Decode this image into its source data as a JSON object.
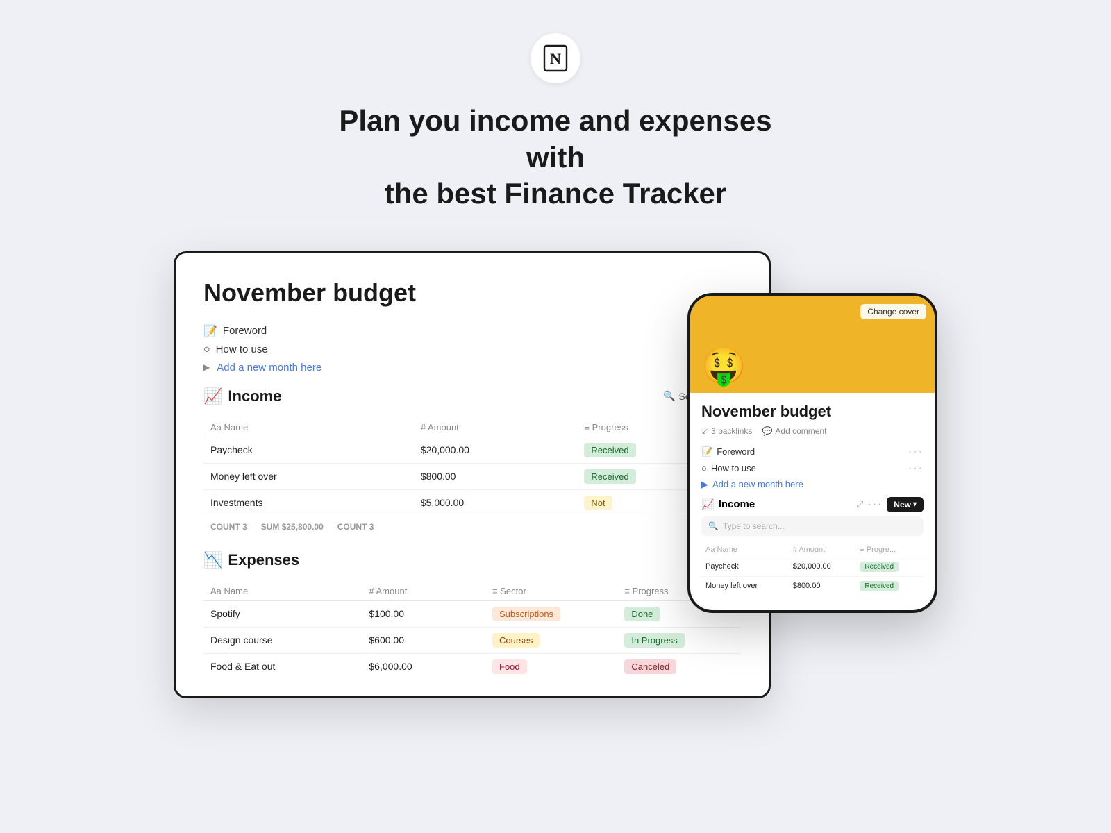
{
  "hero": {
    "title_line1": "Plan you income and expenses with",
    "title_line2": "the best Finance Tracker"
  },
  "desktop": {
    "page_title": "November budget",
    "nav_items": [
      {
        "icon": "📝",
        "label": "Foreword",
        "type": "page"
      },
      {
        "icon": "○",
        "label": "How to use",
        "type": "page"
      },
      {
        "icon": "▶",
        "label": "Add a new month here",
        "type": "link"
      }
    ],
    "income_section": {
      "title": "Income",
      "icon": "📈",
      "search_label": "Search",
      "columns": [
        "Name",
        "Amount",
        "Progress"
      ],
      "rows": [
        {
          "name": "Paycheck",
          "amount": "$20,000.00",
          "progress": "Received",
          "progress_type": "received"
        },
        {
          "name": "Money left over",
          "amount": "$800.00",
          "progress": "Received",
          "progress_type": "received"
        },
        {
          "name": "Investments",
          "amount": "$5,000.00",
          "progress": "Not",
          "progress_type": "not"
        }
      ],
      "footer": {
        "count": "3",
        "sum": "$25,800.00",
        "count2": "3"
      }
    },
    "expenses_section": {
      "title": "Expenses",
      "icon": "📉",
      "columns": [
        "Name",
        "Amount",
        "Sector",
        "Progress"
      ],
      "rows": [
        {
          "name": "Spotify",
          "amount": "$100.00",
          "sector": "Subscriptions",
          "sector_type": "subscriptions",
          "progress": "Done",
          "progress_type": "done"
        },
        {
          "name": "Design course",
          "amount": "$600.00",
          "sector": "Courses",
          "sector_type": "courses",
          "progress": "In Progress",
          "progress_type": "in-progress"
        },
        {
          "name": "Food & Eat out",
          "amount": "$6,000.00",
          "sector": "Food",
          "sector_type": "food",
          "progress": "Canceled",
          "progress_type": "canceled"
        }
      ]
    }
  },
  "mobile": {
    "cover_emoji": "🤑",
    "change_cover_label": "Change cover",
    "page_title": "November budget",
    "backlinks_label": "3 backlinks",
    "add_comment_label": "Add comment",
    "nav_items": [
      {
        "icon": "📝",
        "label": "Foreword",
        "type": "page"
      },
      {
        "icon": "○",
        "label": "How to use",
        "type": "page"
      },
      {
        "icon": "▶",
        "label": "Add a new month here",
        "type": "link"
      }
    ],
    "income_section": {
      "title": "Income",
      "icon": "📈",
      "new_label": "New",
      "search_placeholder": "Type to search...",
      "columns": [
        "Name",
        "Amount",
        "Progre..."
      ],
      "rows": [
        {
          "name": "Paycheck",
          "amount": "$20,000.00",
          "progress": "Received",
          "progress_type": "received"
        },
        {
          "name": "Money left over",
          "amount": "$800.00",
          "progress": "Received",
          "progress_type": "received"
        }
      ]
    }
  },
  "badges": {
    "received": {
      "label": "Received",
      "bg": "#d4edda",
      "color": "#1a6b2f"
    },
    "not": {
      "label": "Not",
      "bg": "#fff3cd",
      "color": "#856404"
    },
    "done": {
      "label": "Done",
      "bg": "#d4edda",
      "color": "#1a6b2f"
    },
    "in_progress": {
      "label": "In Progress",
      "bg": "#d4edda",
      "color": "#1a6b2f"
    },
    "canceled": {
      "label": "Canceled",
      "bg": "#f8d7da",
      "color": "#842029"
    }
  }
}
